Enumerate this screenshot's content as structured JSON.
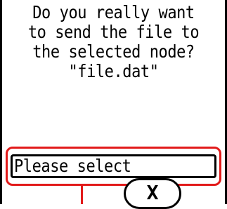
{
  "dialog": {
    "message_lines": [
      "Do you really want",
      "to send the file to",
      "the selected node?",
      "\"file.dat\""
    ]
  },
  "node_select": {
    "value": "Please select"
  },
  "close_button": {
    "label": "X"
  },
  "colors": {
    "highlight": "#e21a1a",
    "foreground": "#000000",
    "background": "#ffffff"
  }
}
